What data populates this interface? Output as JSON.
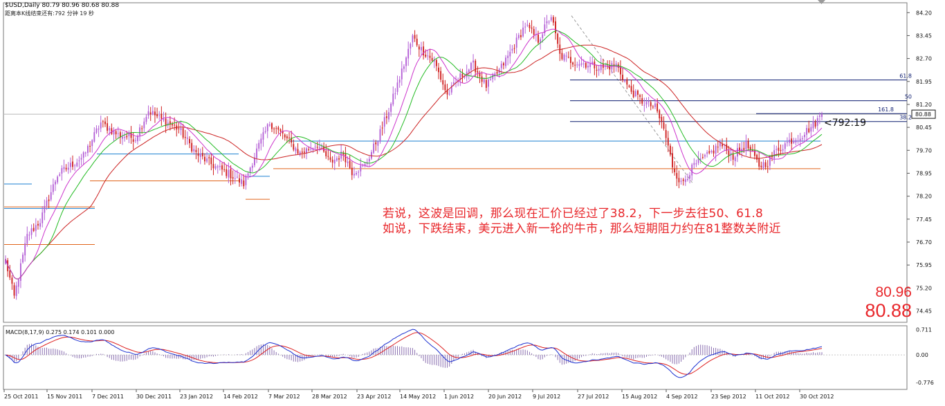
{
  "header": {
    "symbol_line": "$USD,Daily  80.79 80.96 80.68 80.88",
    "countdown_line": "距离本K线结束还有:792 分钟 19 秒"
  },
  "chart_data": [
    {
      "type": "candlestick",
      "symbol": "$USD",
      "timeframe": "Daily",
      "ohlc_last": {
        "open": 80.79,
        "high": 80.96,
        "low": 80.68,
        "close": 80.88
      },
      "current_price_label": "80.88",
      "ylim": [
        74.1,
        84.5
      ],
      "y_ticks": [
        "84.20",
        "83.45",
        "82.70",
        "81.95",
        "81.20",
        "80.45",
        "79.70",
        "78.95",
        "78.20",
        "77.45",
        "76.70",
        "75.95",
        "75.20",
        "74.45"
      ],
      "x_ticks": [
        "25 Oct 2011",
        "15 Nov 2011",
        "7 Dec 2011",
        "30 Dec 2011",
        "23 Jan 2012",
        "14 Feb 2012",
        "7 Mar 2012",
        "28 Mar 2012",
        "23 Apr 2012",
        "14 May 2012",
        "1 Jun 2012",
        "20 Jun 2012",
        "9 Jul 2012",
        "27 Jul 2012",
        "15 Aug 2012",
        "4 Sep 2012",
        "23 Sep 2012",
        "11 Oct 2012",
        "30 Oct 2012"
      ],
      "trend_anchors": [
        [
          0,
          76.1
        ],
        [
          4,
          74.9
        ],
        [
          10,
          76.9
        ],
        [
          16,
          77.4
        ],
        [
          24,
          78.9
        ],
        [
          30,
          79.2
        ],
        [
          36,
          79.5
        ],
        [
          44,
          80.6
        ],
        [
          52,
          80.2
        ],
        [
          60,
          80.1
        ],
        [
          66,
          81.0
        ],
        [
          72,
          80.7
        ],
        [
          80,
          80.4
        ],
        [
          88,
          79.6
        ],
        [
          96,
          79.2
        ],
        [
          104,
          78.9
        ],
        [
          110,
          78.6
        ],
        [
          116,
          79.7
        ],
        [
          122,
          80.6
        ],
        [
          128,
          80.2
        ],
        [
          136,
          79.6
        ],
        [
          144,
          79.9
        ],
        [
          150,
          79.3
        ],
        [
          156,
          79.6
        ],
        [
          160,
          79.0
        ],
        [
          166,
          79.2
        ],
        [
          172,
          80.1
        ],
        [
          178,
          81.2
        ],
        [
          184,
          82.5
        ],
        [
          188,
          83.4
        ],
        [
          192,
          83.0
        ],
        [
          198,
          82.6
        ],
        [
          204,
          81.5
        ],
        [
          210,
          82.1
        ],
        [
          216,
          82.5
        ],
        [
          222,
          81.8
        ],
        [
          228,
          82.3
        ],
        [
          234,
          83.0
        ],
        [
          240,
          83.8
        ],
        [
          246,
          83.3
        ],
        [
          252,
          84.1
        ],
        [
          256,
          82.8
        ],
        [
          262,
          82.6
        ],
        [
          270,
          82.5
        ],
        [
          276,
          82.4
        ],
        [
          282,
          82.5
        ],
        [
          288,
          81.7
        ],
        [
          294,
          81.3
        ],
        [
          300,
          81.1
        ],
        [
          304,
          80.4
        ],
        [
          308,
          79.2
        ],
        [
          312,
          78.6
        ],
        [
          318,
          79.2
        ],
        [
          324,
          79.5
        ],
        [
          330,
          79.9
        ],
        [
          336,
          79.5
        ],
        [
          342,
          79.9
        ],
        [
          348,
          79.2
        ],
        [
          352,
          79.3
        ],
        [
          356,
          79.7
        ],
        [
          362,
          80.0
        ],
        [
          368,
          80.2
        ],
        [
          374,
          80.6
        ],
        [
          377,
          80.88
        ]
      ],
      "fib_levels": [
        {
          "label": "61.8",
          "value": 82.0
        },
        {
          "label": "50",
          "value": 81.32
        },
        {
          "label": "161.8",
          "value": 80.9
        },
        {
          "label": "38.2",
          "value": 80.64
        }
      ],
      "horizontal_levels": [
        80.0,
        79.1,
        79.58,
        78.7,
        78.1,
        78.6,
        77.85,
        76.62
      ],
      "annotation_arrow": "<792:19",
      "notes": [
        "若说，这波是回调，那么现在汇价已经过了38.2，下一步去往50、61.8",
        "如说，下跌结束，美元进入新一轮的牛市，那么短期阻力约在81整数关附近"
      ],
      "price_high_label": "80.96",
      "price_close_label": "80.88",
      "colors": {
        "bull": "#b45fd6",
        "bear": "#cf1e1e",
        "ma_fast": "#cc33cc",
        "ma_mid": "#22bb22",
        "ma_slow": "#cc2222",
        "fib": "#0a1a6e",
        "level_blue": "#1a7fd0",
        "level_orange": "#e0641a"
      }
    },
    {
      "type": "macd",
      "title": "MACD(8,17,9) 0.275 0.174 0.101 0.000",
      "params": [
        8,
        17,
        9
      ],
      "values": {
        "macd": 0.275,
        "signal": 0.174,
        "histogram": 0.101,
        "level": 0.0
      },
      "y_ticks": [
        "0.711",
        "0.00",
        "-0.776"
      ],
      "ylim": [
        -0.95,
        0.8
      ],
      "colors": {
        "macd": "#1a2fd0",
        "signal": "#dd1e1e",
        "histogram": "#8a6fb0"
      }
    }
  ]
}
